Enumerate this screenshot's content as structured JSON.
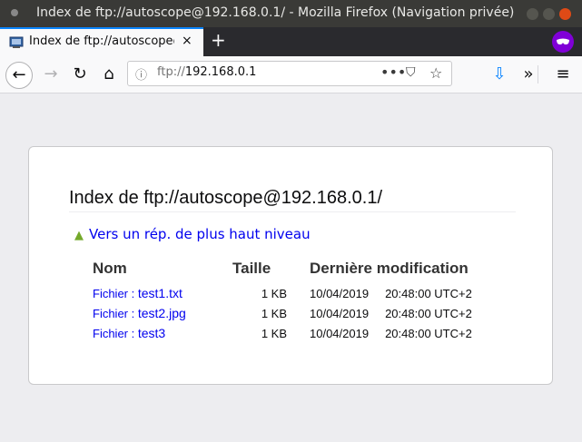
{
  "window": {
    "title": "Index de ftp://autoscope@192.168.0.1/ - Mozilla Firefox (Navigation privée)"
  },
  "tabs": [
    {
      "label": "Index de ftp://autoscope@192.168.0.1/",
      "close": "×"
    }
  ],
  "newtab": "+",
  "navbar": {
    "back": "←",
    "forward": "→",
    "reload": "↻",
    "home": "⌂",
    "url_prefix": "ftp://",
    "url_host": "192.168.0.1",
    "page_actions": "•••",
    "pocket": "⛉",
    "star": "☆",
    "download": "⇩",
    "overflow": "»",
    "menu": "≡"
  },
  "page": {
    "heading": "Index de ftp://autoscope@192.168.0.1/",
    "up_label": "Vers un rép. de plus haut niveau",
    "columns": [
      "Nom",
      "Taille",
      "Dernière modification"
    ],
    "rows": [
      {
        "prefix": "Fichier : ",
        "name": "test1.txt",
        "size": "1 KB",
        "date": "10/04/2019",
        "time": "20:48:00 UTC+2"
      },
      {
        "prefix": "Fichier : ",
        "name": "test2.jpg",
        "size": "1 KB",
        "date": "10/04/2019",
        "time": "20:48:00 UTC+2"
      },
      {
        "prefix": "Fichier : ",
        "name": "test3",
        "size": "1 KB",
        "date": "10/04/2019",
        "time": "20:48:00 UTC+2"
      }
    ]
  },
  "colors": {
    "accent": "#0a84ff",
    "link": "#0000ee",
    "private": "#8000d7",
    "up_arrow": "#74a92a"
  }
}
